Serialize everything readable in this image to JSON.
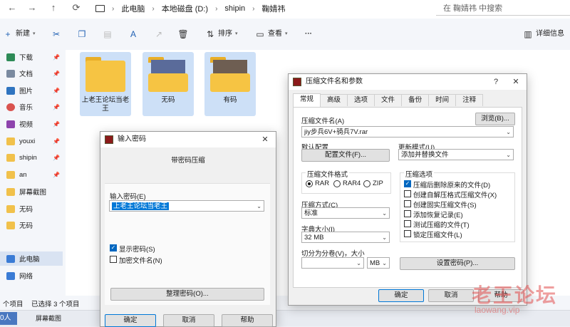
{
  "addressbar": {
    "crumbs": [
      "此电脑",
      "本地磁盘 (D:)",
      "shipin",
      "鞠婧祎"
    ],
    "search_placeholder": "在 鞠婧祎 中搜索"
  },
  "toolbar": {
    "new_label": "新建",
    "sort_label": "排序",
    "view_label": "查看",
    "more_label": "···",
    "details_label": "详细信息"
  },
  "sidebar": {
    "items": [
      {
        "label": "下载",
        "icon": "download-icon"
      },
      {
        "label": "文档",
        "icon": "document-icon"
      },
      {
        "label": "图片",
        "icon": "picture-icon"
      },
      {
        "label": "音乐",
        "icon": "music-icon"
      },
      {
        "label": "视频",
        "icon": "video-icon"
      },
      {
        "label": "youxi",
        "icon": "folder-icon"
      },
      {
        "label": "shipin",
        "icon": "folder-icon"
      },
      {
        "label": "an",
        "icon": "folder-icon"
      },
      {
        "label": "屏幕截图",
        "icon": "folder-icon"
      },
      {
        "label": "无码",
        "icon": "folder-icon"
      },
      {
        "label": "无码",
        "icon": "folder-icon"
      },
      {
        "label": "此电脑",
        "icon": "computer-icon"
      },
      {
        "label": "网络",
        "icon": "network-icon"
      }
    ]
  },
  "files": [
    {
      "name": "上老王论坛当老王"
    },
    {
      "name": "无码"
    },
    {
      "name": "有码"
    }
  ],
  "statusbar": {
    "count": "个项目",
    "selected": "已选择 3 个项目",
    "taskbar_left": "0人",
    "taskbar_item": "屏幕截图"
  },
  "password_dialog": {
    "title": "输入密码",
    "subtitle": "带密码压缩",
    "input_label": "输入密码(E)",
    "input_value": "上老王论坛当老王",
    "show_password": "显示密码(S)",
    "encrypt_names": "加密文件名(N)",
    "organize_button": "整理密码(O)...",
    "ok_button": "确定",
    "cancel_button": "取消",
    "help_button": "帮助"
  },
  "archive_dialog": {
    "title": "压缩文件名和参数",
    "help_glyph": "?",
    "tabs": [
      "常规",
      "高级",
      "选项",
      "文件",
      "备份",
      "时间",
      "注释"
    ],
    "archive_name_label": "压缩文件名(A)",
    "browse_button": "浏览(B)...",
    "archive_name_value": "jiy步兵6V+骑兵7V.rar",
    "default_config_label": "默认配置",
    "profiles_button": "配置文件(F)...",
    "update_mode_label": "更新模式(U)",
    "update_mode_value": "添加并替换文件",
    "format_group": "压缩文件格式",
    "formats": [
      "RAR",
      "RAR4",
      "ZIP"
    ],
    "selected_format": "RAR",
    "method_label": "压缩方式(C)",
    "method_value": "标准",
    "dict_label": "字典大小(I)",
    "dict_value": "32 MB",
    "split_label": "切分为分卷(V)，大小",
    "split_unit": "MB",
    "options_group": "压缩选项",
    "options": [
      {
        "label": "压缩后删除原来的文件(D)",
        "checked": true
      },
      {
        "label": "创建自解压格式压缩文件(X)",
        "checked": false
      },
      {
        "label": "创建固实压缩文件(S)",
        "checked": false
      },
      {
        "label": "添加恢复记录(E)",
        "checked": false
      },
      {
        "label": "测试压缩的文件(T)",
        "checked": false
      },
      {
        "label": "锁定压缩文件(L)",
        "checked": false
      }
    ],
    "set_password_button": "设置密码(P)...",
    "ok_button": "确定",
    "cancel_button": "取消",
    "help_button": "帮助"
  },
  "watermark": {
    "text": "老王论坛",
    "url": "laowang.vip"
  }
}
